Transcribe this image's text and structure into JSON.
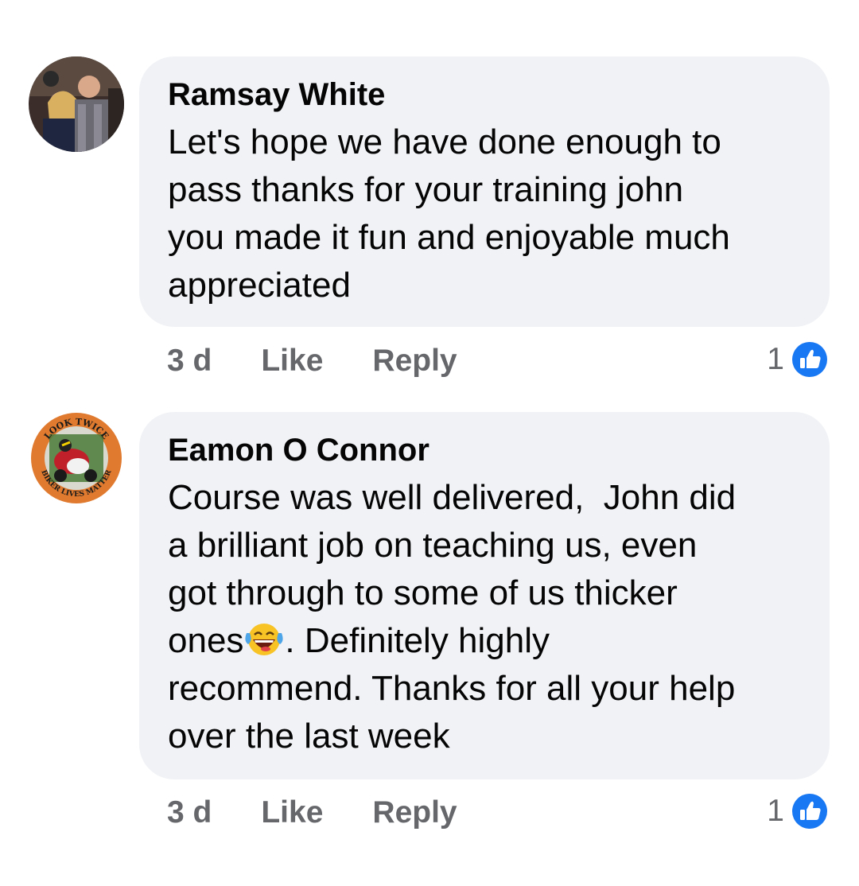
{
  "comments": [
    {
      "author": "Ramsay White",
      "text_lines": [
        "Let's hope we have done enough to",
        "pass thanks for your training john",
        "you made it fun and enjoyable much",
        "appreciated"
      ],
      "time": "3 d",
      "like_label": "Like",
      "reply_label": "Reply",
      "reaction_count": "1",
      "reaction_icon": "like-reaction-icon"
    },
    {
      "author": "Eamon O Connor",
      "text_lines": [
        "Course was well delivered,  John did",
        "a brilliant job on teaching us, even",
        "got through to some of us thicker"
      ],
      "text_line4_before": "ones",
      "text_line4_emoji": "laughing-crying-emoji-icon",
      "text_line4_after": ". Definitely highly",
      "text_lines_tail": [
        "recommend. Thanks for all your help",
        "over the last week"
      ],
      "avatar_badge_top": "LOOK TWICE",
      "avatar_badge_bottom": "BIKER LIVES MATTER",
      "time": "3 d",
      "like_label": "Like",
      "reply_label": "Reply",
      "reaction_count": "1",
      "reaction_icon": "like-reaction-icon"
    }
  ],
  "colors": {
    "bubble": "#f0f2f5",
    "meta_text": "#65676b",
    "like_blue": "#1877f2"
  }
}
